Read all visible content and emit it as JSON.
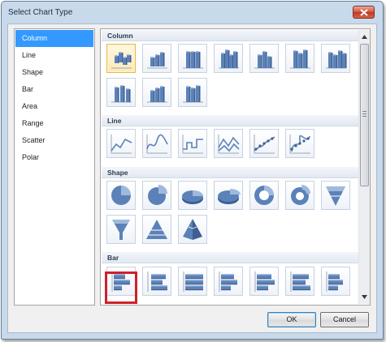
{
  "dialog": {
    "title": "Select Chart Type",
    "ok_label": "OK",
    "cancel_label": "Cancel"
  },
  "chart_types": [
    {
      "label": "Column",
      "selected": true
    },
    {
      "label": "Line",
      "selected": false
    },
    {
      "label": "Shape",
      "selected": false
    },
    {
      "label": "Bar",
      "selected": false
    },
    {
      "label": "Area",
      "selected": false
    },
    {
      "label": "Range",
      "selected": false
    },
    {
      "label": "Scatter",
      "selected": false
    },
    {
      "label": "Polar",
      "selected": false
    }
  ],
  "gallery": {
    "sections": [
      {
        "title": "Column",
        "icon": "column-chart-icon",
        "count": 10,
        "selected_index": 0
      },
      {
        "title": "Line",
        "icon": "line-chart-icon",
        "count": 6
      },
      {
        "title": "Shape",
        "icon": "shape-chart-icon",
        "count": 10
      },
      {
        "title": "Bar",
        "icon": "bar-chart-icon",
        "count": 7,
        "highlighted_index": 0
      }
    ]
  },
  "colors": {
    "selection": "#3399ff",
    "highlight": "#d0202a",
    "icon_blue": "#5b82b8"
  }
}
